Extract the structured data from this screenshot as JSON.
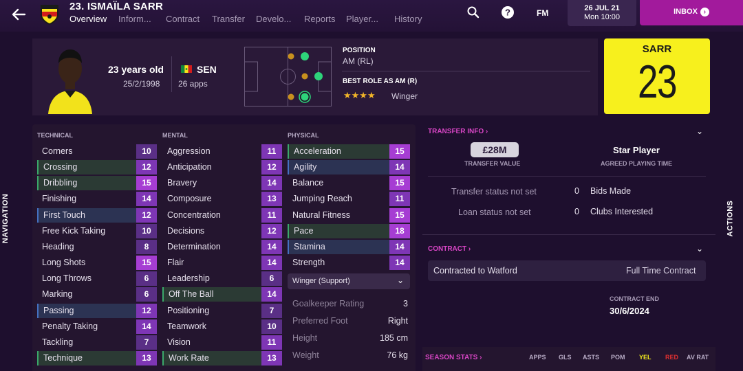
{
  "header": {
    "title": "23. ISMAÏLA SARR",
    "tabs": [
      "Overview",
      "Inform...",
      "Contract",
      "Transfer",
      "Develo...",
      "Reports",
      "Player...",
      "History"
    ],
    "active_tab": "Overview",
    "fm_label": "FM",
    "date": "26 JUL 21",
    "time": "Mon 10:00",
    "inbox_label": "INBOX"
  },
  "profile": {
    "age": "23 years old",
    "dob": "25/2/1998",
    "nation": "SEN",
    "apps": "26 apps",
    "position_heading": "POSITION",
    "position_value": "AM (RL)",
    "role_heading": "BEST ROLE AS AM (R)",
    "role_stars": "★★★★",
    "role_star_rating": 4,
    "role_name": "Winger",
    "shirt_name": "SARR",
    "shirt_number": "23"
  },
  "side_labels": {
    "navigation": "NAVIGATION",
    "actions": "ACTIONS"
  },
  "attributes": {
    "technical_heading": "TECHNICAL",
    "mental_heading": "MENTAL",
    "physical_heading": "PHYSICAL",
    "technical": [
      {
        "name": "Corners",
        "value": "10"
      },
      {
        "name": "Crossing",
        "value": "12"
      },
      {
        "name": "Dribbling",
        "value": "15"
      },
      {
        "name": "Finishing",
        "value": "14"
      },
      {
        "name": "First Touch",
        "value": "12"
      },
      {
        "name": "Free Kick Taking",
        "value": "10"
      },
      {
        "name": "Heading",
        "value": "8"
      },
      {
        "name": "Long Shots",
        "value": "15"
      },
      {
        "name": "Long Throws",
        "value": "6"
      },
      {
        "name": "Marking",
        "value": "6"
      },
      {
        "name": "Passing",
        "value": "12"
      },
      {
        "name": "Penalty Taking",
        "value": "14"
      },
      {
        "name": "Tackling",
        "value": "7"
      },
      {
        "name": "Technique",
        "value": "13"
      }
    ],
    "mental": [
      {
        "name": "Aggression",
        "value": "11"
      },
      {
        "name": "Anticipation",
        "value": "12"
      },
      {
        "name": "Bravery",
        "value": "14"
      },
      {
        "name": "Composure",
        "value": "13"
      },
      {
        "name": "Concentration",
        "value": "11"
      },
      {
        "name": "Decisions",
        "value": "12"
      },
      {
        "name": "Determination",
        "value": "14"
      },
      {
        "name": "Flair",
        "value": "14"
      },
      {
        "name": "Leadership",
        "value": "6"
      },
      {
        "name": "Off The Ball",
        "value": "14"
      },
      {
        "name": "Positioning",
        "value": "7"
      },
      {
        "name": "Teamwork",
        "value": "10"
      },
      {
        "name": "Vision",
        "value": "11"
      },
      {
        "name": "Work Rate",
        "value": "13"
      }
    ],
    "physical": [
      {
        "name": "Acceleration",
        "value": "15"
      },
      {
        "name": "Agility",
        "value": "14"
      },
      {
        "name": "Balance",
        "value": "15"
      },
      {
        "name": "Jumping Reach",
        "value": "11"
      },
      {
        "name": "Natural Fitness",
        "value": "15"
      },
      {
        "name": "Pace",
        "value": "18"
      },
      {
        "name": "Stamina",
        "value": "14"
      },
      {
        "name": "Strength",
        "value": "14"
      }
    ],
    "role_select": "Winger (Support)",
    "extra_info": [
      {
        "label": "Goalkeeper Rating",
        "value": "3"
      },
      {
        "label": "Preferred Foot",
        "value": "Right"
      },
      {
        "label": "Height",
        "value": "185 cm"
      },
      {
        "label": "Weight",
        "value": "76 kg"
      }
    ]
  },
  "transfer": {
    "section_title": "TRANSFER INFO",
    "value": "£28M",
    "value_label": "TRANSFER VALUE",
    "playing_time": "Star Player",
    "playing_time_label": "AGREED PLAYING TIME",
    "transfer_status": "Transfer status not set",
    "loan_status": "Loan status not set",
    "bids_count": "0",
    "bids_label": "Bids Made",
    "clubs_count": "0",
    "clubs_label": "Clubs Interested"
  },
  "contract": {
    "section_title": "CONTRACT",
    "contracted_to": "Contracted to Watford",
    "contract_type": "Full Time Contract",
    "end_label": "CONTRACT END",
    "end_date": "30/6/2024"
  },
  "season_stats": {
    "section_title": "SEASON STATS",
    "columns": [
      "APPS",
      "GLS",
      "ASTS",
      "POM",
      "YEL",
      "RED",
      "AV RAT"
    ]
  },
  "colors": {
    "accent": "#a21a9c",
    "section_title": "#d946c6",
    "shirt": "#f7f01d",
    "stars": "#f0b429"
  }
}
